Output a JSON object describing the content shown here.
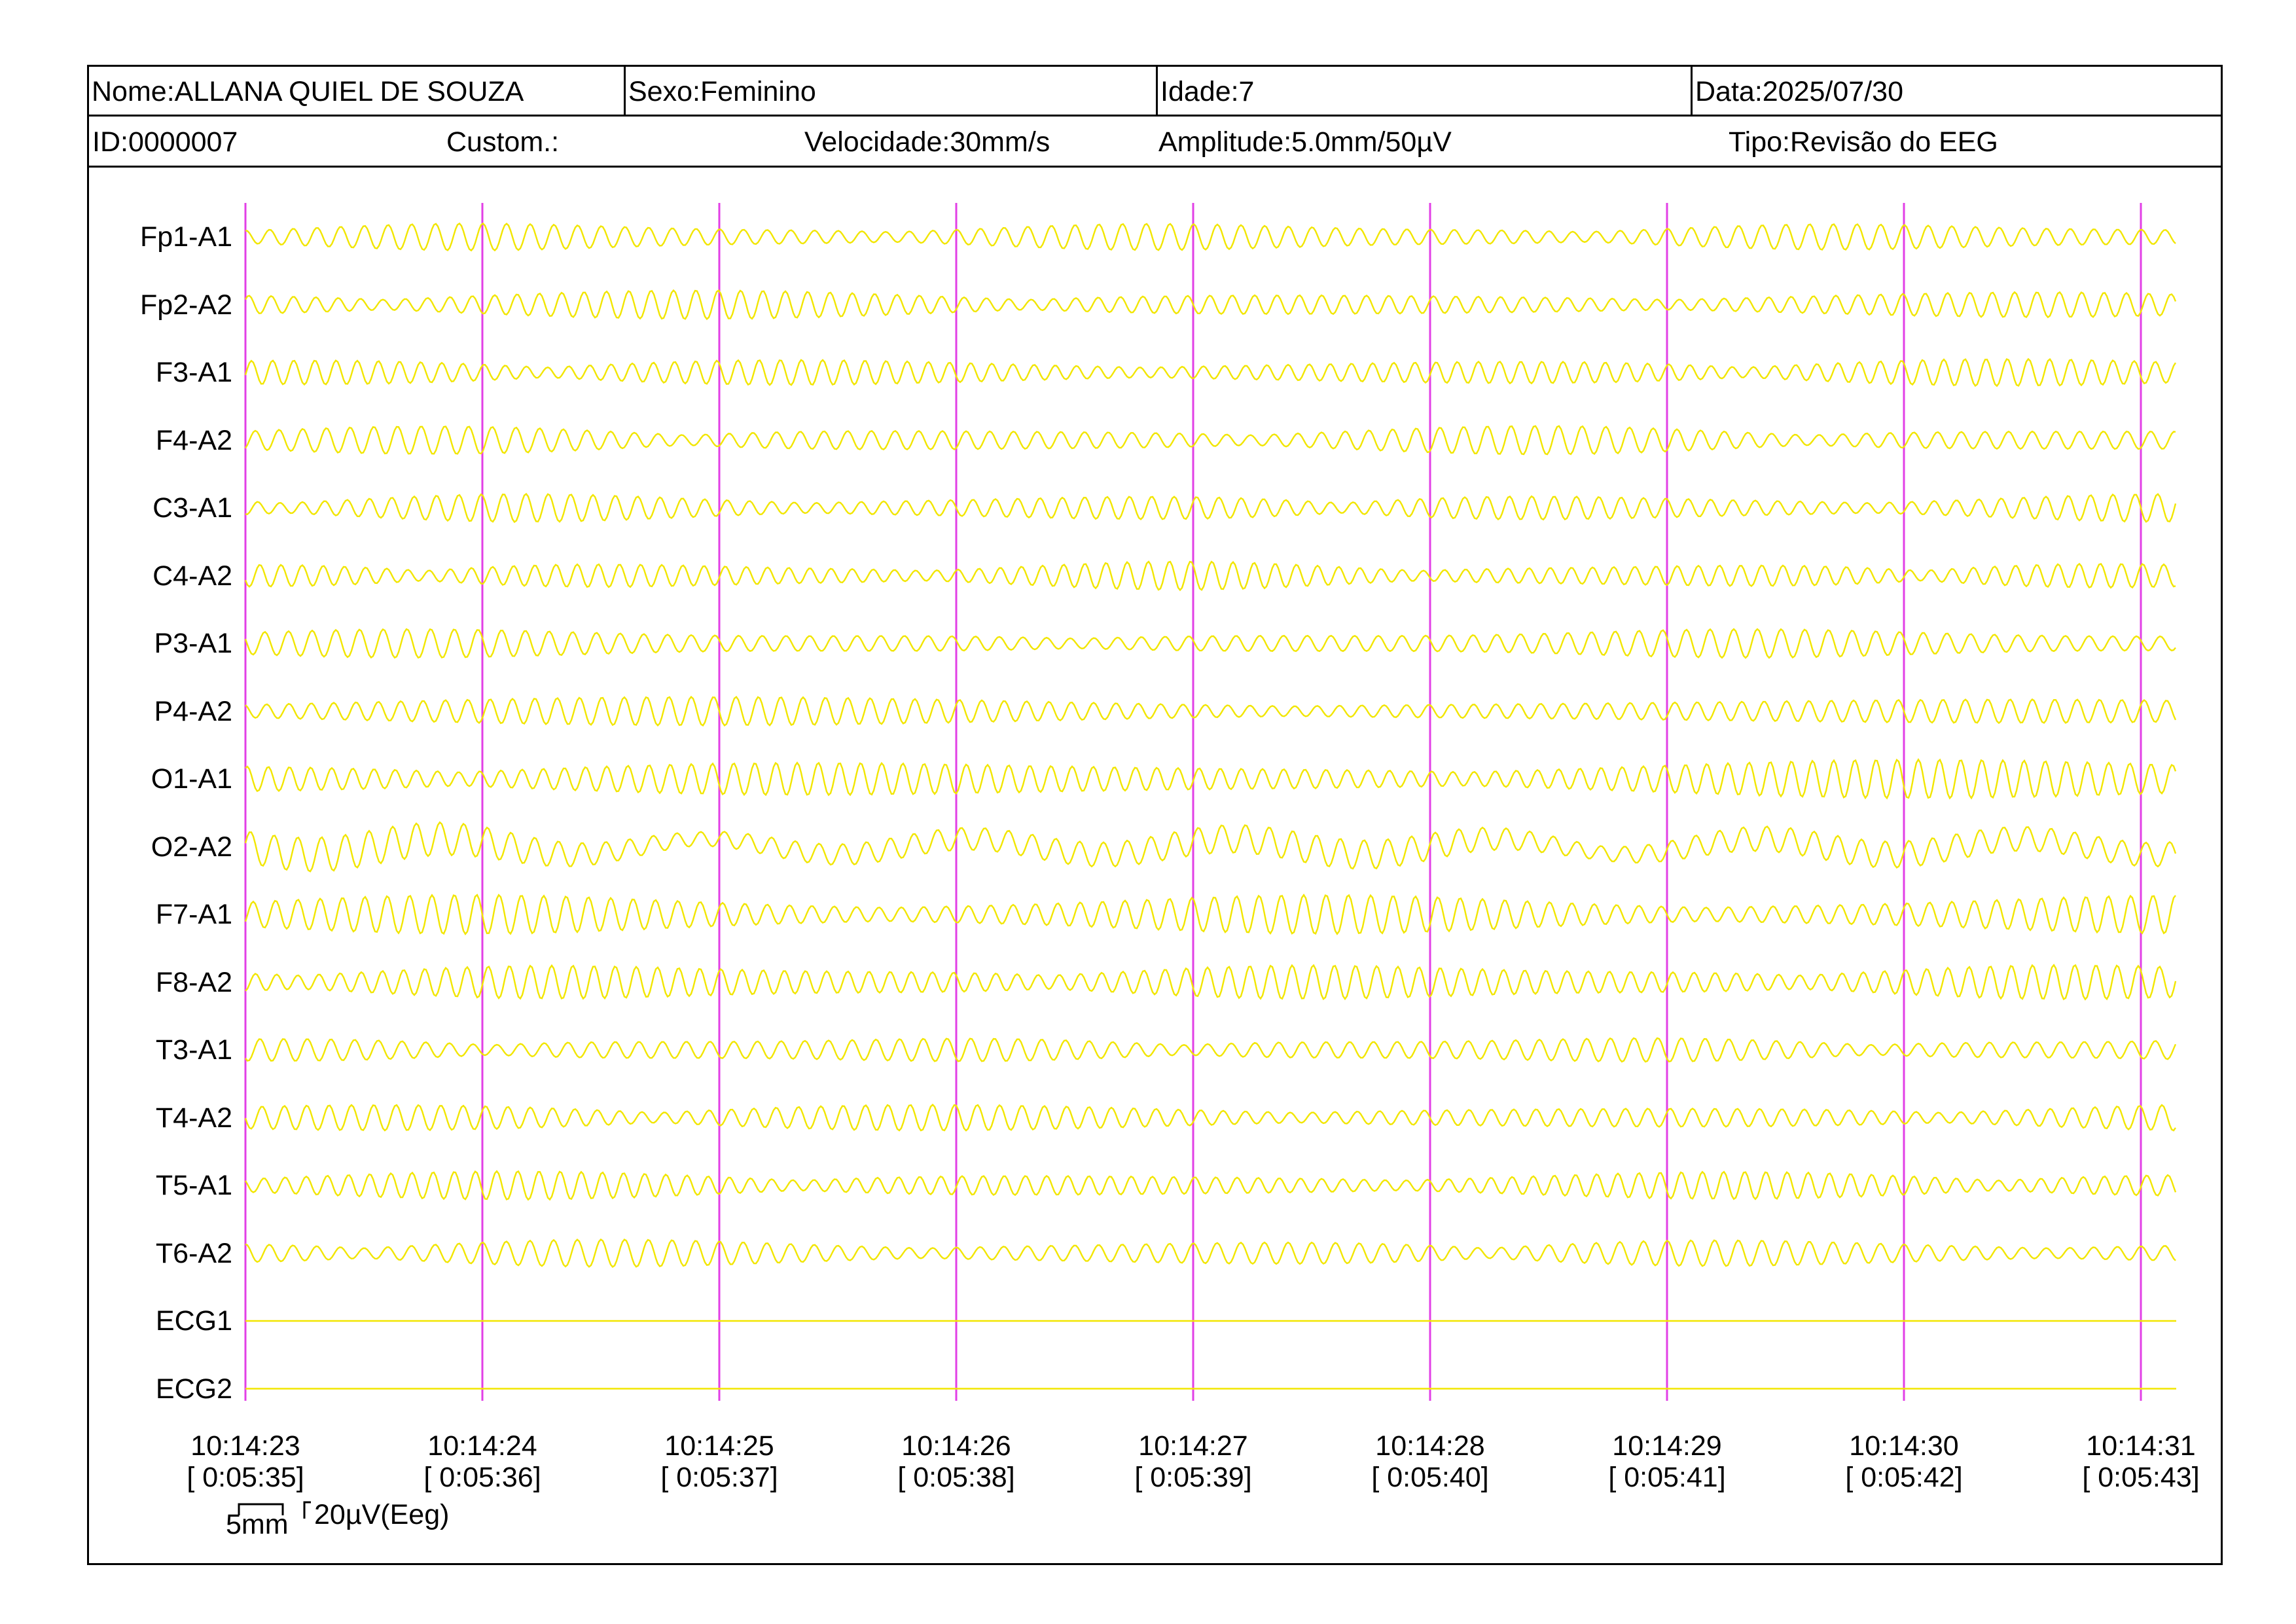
{
  "header": {
    "name": "Nome:ALLANA QUIEL DE SOUZA",
    "sex": "Sexo:Feminino",
    "age": "Idade:7",
    "date": "Data:2025/07/30",
    "id": "ID:0000007",
    "custom": "Custom.:",
    "speed": "Velocidade:30mm/s",
    "amplitude": "Amplitude:5.0mm/50µV",
    "type": "Tipo:Revisão do EEG"
  },
  "colors": {
    "trace": "#f2e600",
    "marker": "#e23fe6",
    "border": "#000000"
  },
  "channels": [
    "Fp1-A1",
    "Fp2-A2",
    "F3-A1",
    "F4-A2",
    "C3-A1",
    "C4-A2",
    "P3-A1",
    "P4-A2",
    "O1-A1",
    "O2-A2",
    "F7-A1",
    "F8-A2",
    "T3-A1",
    "T4-A2",
    "T5-A1",
    "T6-A2",
    "ECG1",
    "ECG2"
  ],
  "flat_channels": [
    "ECG1",
    "ECG2"
  ],
  "time_marks": [
    {
      "clock": "10:14:23",
      "elapsed": "[ 0:05:35]"
    },
    {
      "clock": "10:14:24",
      "elapsed": "[ 0:05:36]"
    },
    {
      "clock": "10:14:25",
      "elapsed": "[ 0:05:37]"
    },
    {
      "clock": "10:14:26",
      "elapsed": "[ 0:05:38]"
    },
    {
      "clock": "10:14:27",
      "elapsed": "[ 0:05:39]"
    },
    {
      "clock": "10:14:28",
      "elapsed": "[ 0:05:40]"
    },
    {
      "clock": "10:14:29",
      "elapsed": "[ 0:05:41]"
    },
    {
      "clock": "10:14:30",
      "elapsed": "[ 0:05:42]"
    },
    {
      "clock": "10:14:31",
      "elapsed": "[ 0:05:43]"
    }
  ],
  "scale": {
    "mm_label": "5mm",
    "amp_label": "20µV(Eeg)"
  }
}
